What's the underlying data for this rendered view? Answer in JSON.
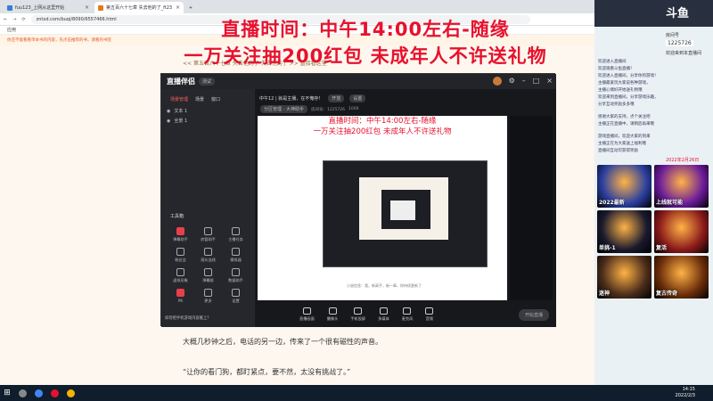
{
  "browser": {
    "tabs": [
      {
        "label": "fuu123_上网从这里开始"
      },
      {
        "label": "第五百六十七章 失去他的了_ft23"
      }
    ],
    "url": "zntxd.com/buqi/8090/6557466.html",
    "bookmarks_label": "应用",
    "notice": "你还不能看看单本书的内容，先点击推荐的书，请看的书签"
  },
  "overlay": {
    "line1": "直播时间：中午14:00左右-随缘",
    "line2": "一万关注抽200红包  未成年人不许送礼物"
  },
  "page": {
    "top_hint": "<< 第五百六十七章 失去他的了 失去他的了 >> 直接看这里",
    "para1": "大概几秒钟之后，电话的另一边，传来了一个很有磁性的声音。",
    "para2": "“让你的看门狗，都盯紧点，要不然，太没有挑战了。”"
  },
  "app": {
    "logo": "直播伴侣",
    "version": "测试",
    "topline": {
      "title": "中午12 | 就是主播，在不俺存！",
      "btn1": "开放",
      "btn2": "设置"
    },
    "topline2": {
      "category": "分区管理 - 大神助手",
      "room": "房间号：1225726",
      "fans": "1000"
    },
    "scene_tabs": [
      "场景管理",
      "场景",
      "窗口"
    ],
    "sources": [
      "文本 1",
      "全景 1"
    ],
    "tools_title": "工具箱",
    "tools": [
      "弹幕助手",
      "房管助手",
      "主播任务",
      "粉丝会",
      "观众连线",
      "模拟器",
      "虚拟形象",
      "弹幕姬",
      "数据助手",
      "PK",
      "更多",
      "设置"
    ],
    "tip": "如何把手机游戏内容搬上？",
    "bottom": [
      "直播画面",
      "摄像头",
      "手机投屏",
      "多媒体",
      "麦克风",
      "音频"
    ],
    "start_label": "开始直播",
    "preview_text": "小说信息：我，新高手，新一章，你持续更新了"
  },
  "side": {
    "logo": "斗鱼",
    "fan_label": "房间号",
    "room": "1225726",
    "viewers": "欢迎来到本直播间",
    "chat": [
      "欢迎进入直播间",
      "欢迎观看斗鱼直播！",
      "欢迎进入直播间，分享你的游戏！",
      "主播最爱玩大家说各种游戏，",
      "主播心情好开始送礼物哦",
      "欢迎来到直播间，分享游戏乐趣，",
      "分享互动奖励多多哦",
      "感谢大家的支持，点个关注吧",
      "主播正在直播中，请稍后再来哦",
      "游戏直播间，欢迎大家的到来",
      "主播正在为大家送上福利哦",
      "直播间互动可获得奖励"
    ],
    "date_label": "2022年2月26日",
    "thumbs": [
      {
        "label": "2022最新",
        "color": "#2a3f9f"
      },
      {
        "label": "上线就可能",
        "color": "#6a1b9a"
      },
      {
        "label": "单挑-1",
        "color": "#1a1a2e"
      },
      {
        "label": "复活",
        "color": "#8b1a1a"
      },
      {
        "label": "迷神",
        "color": "#4a2c1a"
      },
      {
        "label": "复古传奇",
        "color": "#6b2d0a"
      }
    ]
  },
  "taskbar": {
    "time": "14:15",
    "date": "2022/2/3"
  },
  "colors": {
    "accent_red": "#e8112d",
    "dark_bg": "#1e1f24"
  }
}
